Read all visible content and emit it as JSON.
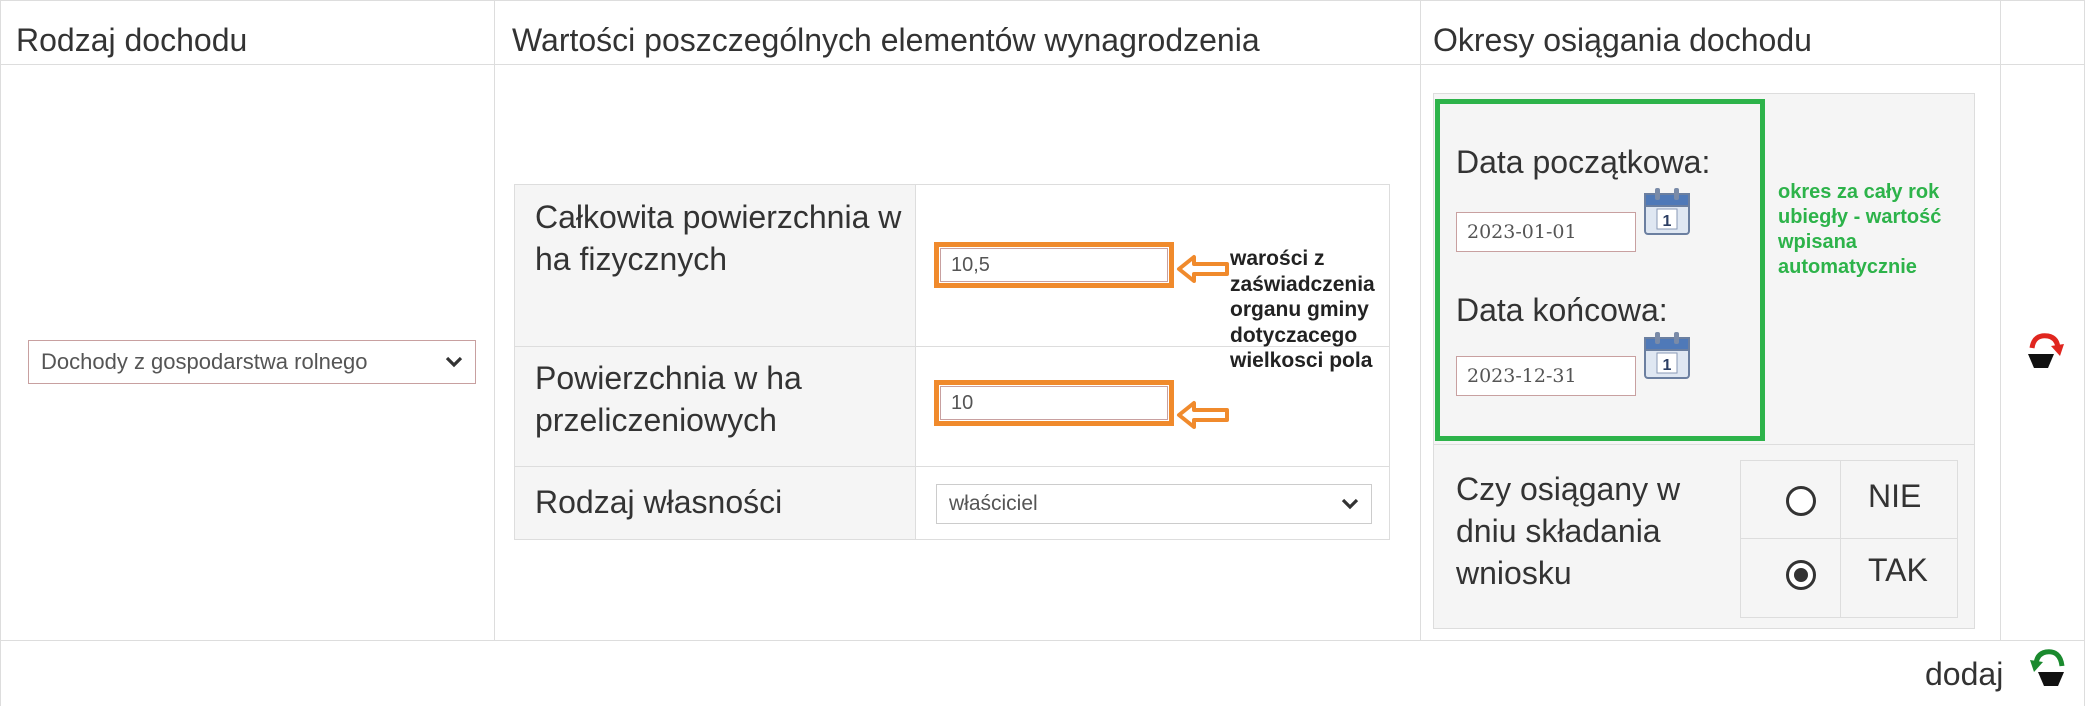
{
  "table": {
    "headers": {
      "income_type": "Rodzaj dochodu",
      "values": "Wartości poszczególnych elementów wynagrodzenia",
      "periods": "Okresy osiągania dochodu"
    }
  },
  "income_type_select": {
    "value": "Dochody z gospodarstwa rolnego"
  },
  "elements": {
    "physical_area": {
      "label": "Całkowita powierzchnia w ha fizycznych",
      "value": "10,5"
    },
    "converted_area": {
      "label": "Powierzchnia w ha przeliczeniowych",
      "value": "10"
    },
    "ownership": {
      "label": "Rodzaj własności",
      "value": "właściciel"
    }
  },
  "annotation_values": "warości z zaświadczenia organu gminy dotyczacego wielkosci pola",
  "period": {
    "start_label": "Data początkowa:",
    "start_value": "2023-01-01",
    "end_label": "Data końcowa:",
    "end_value": "2023-12-31",
    "calendar_day": "1"
  },
  "annotation_period": "okres za cały rok ubiegły - wartość wpisana automatycznie",
  "achieved_question": {
    "label": "Czy osiągany w dniu składania wniosku",
    "option_no": "NIE",
    "option_yes": "TAK",
    "selected": "TAK"
  },
  "add_label": "dodaj",
  "colors": {
    "annotation_orange": "#f08a2c",
    "annotation_green": "#2db34a",
    "icon_red": "#e0261f",
    "icon_green": "#1a8a2e"
  },
  "icons": {
    "remove": "undo-arrow-red-icon",
    "add": "undo-arrow-green-icon",
    "calendar": "calendar-icon"
  }
}
